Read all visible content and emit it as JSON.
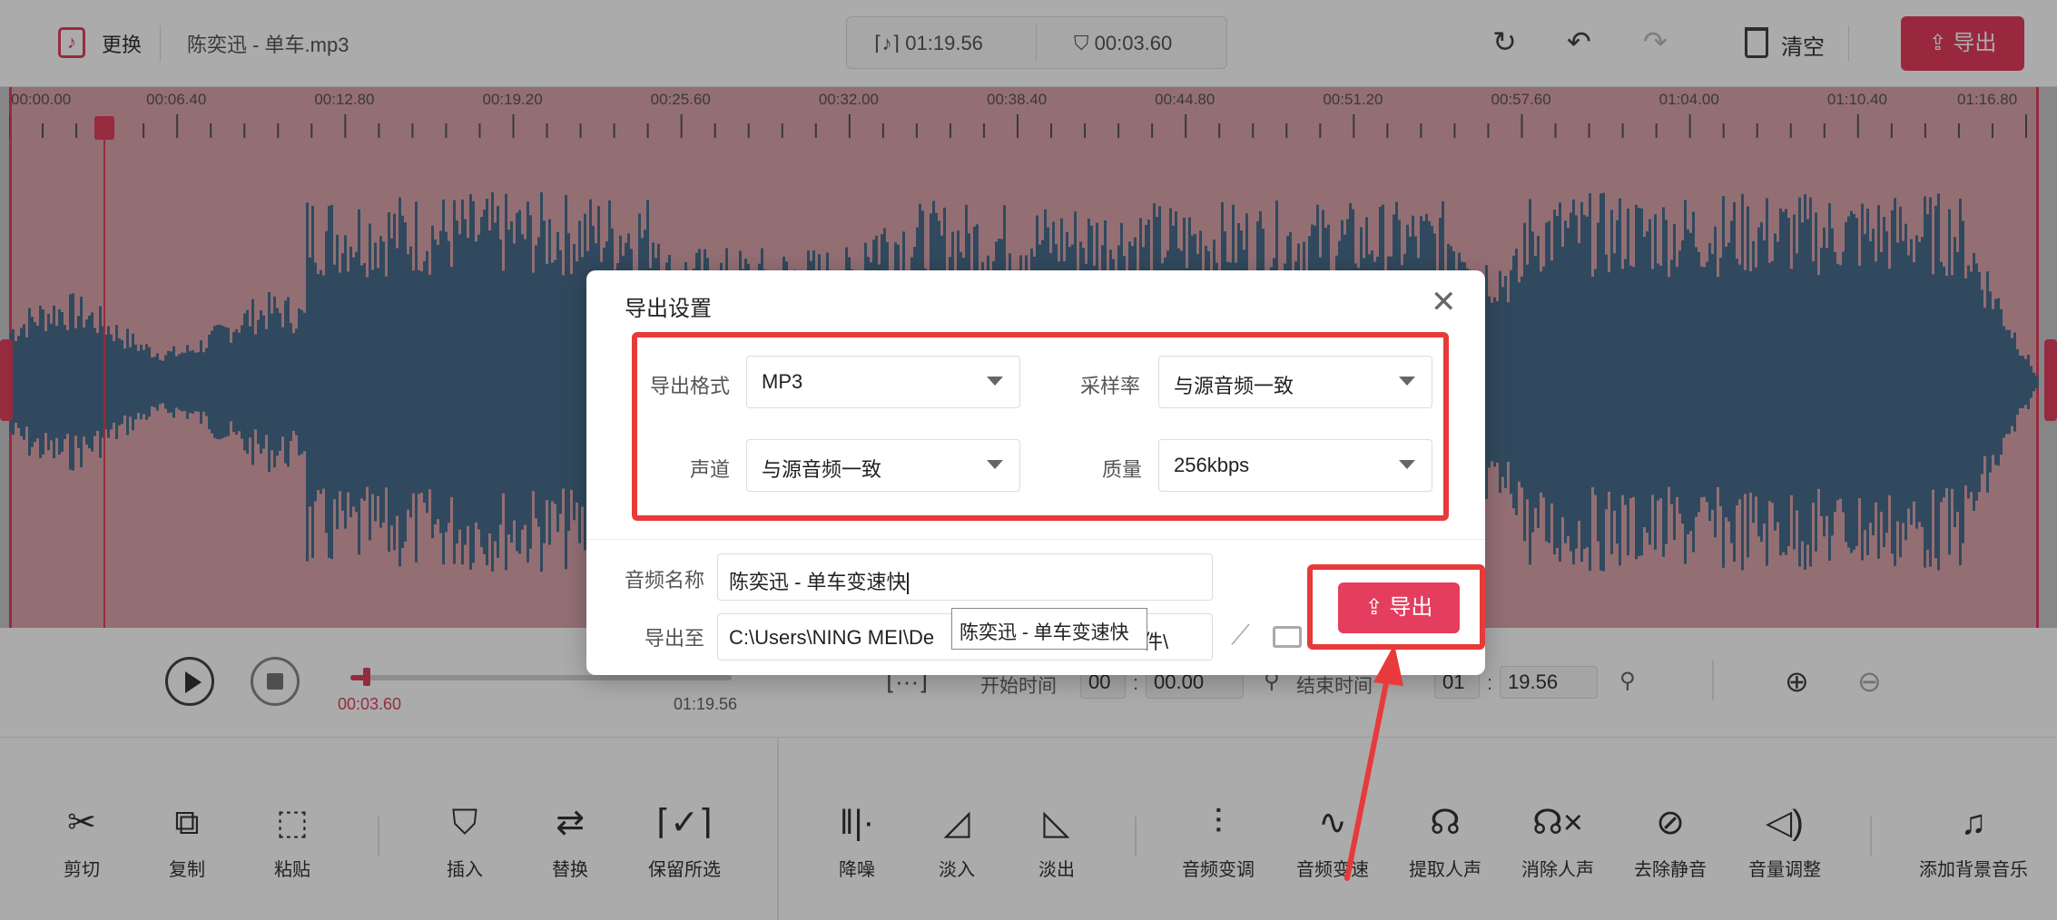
{
  "topbar": {
    "replace_label": "更换",
    "filename": "陈奕迅 - 单车.mp3",
    "total_time": "01:19.56",
    "selected_time": "00:03.60",
    "clear_label": "清空",
    "export_label": "导出"
  },
  "ruler": {
    "labels": [
      "00:00.00",
      "00:06.40",
      "00:12.80",
      "00:19.20",
      "00:25.60",
      "00:32.00",
      "00:38.40",
      "00:44.80",
      "00:51.20",
      "00:57.60",
      "01:04.00",
      "01:10.40",
      "01:16.80"
    ]
  },
  "controls": {
    "current_time": "00:03.60",
    "duration": "01:19.56",
    "start_label": "开始时间",
    "start_min": "00",
    "start_sec": "00.00",
    "end_label": "结束时间",
    "end_min": "01",
    "end_sec": "19.56",
    "progress": 0.045
  },
  "toolbar": {
    "cut": "剪切",
    "copy": "复制",
    "paste": "粘贴",
    "insert": "插入",
    "replace": "替换",
    "keep_selection": "保留所选",
    "denoise": "降噪",
    "fade_in": "淡入",
    "fade_out": "淡出",
    "pitch": "音频变调",
    "speed": "音频变速",
    "extract_vocal": "提取人声",
    "remove_vocal": "消除人声",
    "remove_silence": "去除静音",
    "volume": "音量调整",
    "add_bgm": "添加背景音乐"
  },
  "dialog": {
    "title": "导出设置",
    "format_label": "导出格式",
    "format_value": "MP3",
    "sample_rate_label": "采样率",
    "sample_rate_value": "与源音频一致",
    "channel_label": "声道",
    "channel_value": "与源音频一致",
    "quality_label": "质量",
    "quality_value": "256kbps",
    "name_label": "音频名称",
    "name_value": "陈奕迅 - 单车变速快",
    "path_label": "导出至",
    "path_value_start": "C:\\Users\\NING MEI\\De",
    "path_value_end": "件\\",
    "tooltip": "陈奕迅 - 单车变速快",
    "export_label": "导出"
  },
  "colors": {
    "accent": "#e43d5e",
    "annotation": "#e83a3a",
    "waveform": "#4a6d8c",
    "selection": "#dba6ad"
  }
}
